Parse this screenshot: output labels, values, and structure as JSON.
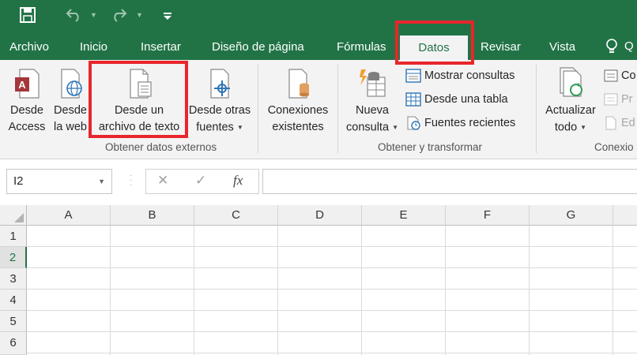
{
  "colors": {
    "accent": "#217346",
    "ribbon_bg": "#f3f3f3",
    "highlight": "#e8262b"
  },
  "qat": {
    "save_icon": "save-icon",
    "undo_icon": "undo-icon",
    "redo_icon": "redo-icon",
    "customize_icon": "customize-qat-icon"
  },
  "tabs": [
    {
      "label": "Archivo"
    },
    {
      "label": "Inicio"
    },
    {
      "label": "Insertar"
    },
    {
      "label": "Diseño de página"
    },
    {
      "label": "Fórmulas"
    },
    {
      "label": "Datos",
      "active": true
    },
    {
      "label": "Revisar"
    },
    {
      "label": "Vista"
    }
  ],
  "tell_me": {
    "icon": "lightbulb-icon",
    "label": "Q"
  },
  "ribbon": {
    "external": {
      "label": "Obtener datos externos",
      "access": {
        "line1": "Desde",
        "line2": "Access"
      },
      "web": {
        "line1": "Desde",
        "line2": "la web"
      },
      "text": {
        "line1": "Desde un",
        "line2": "archivo de texto"
      },
      "other": {
        "line1": "Desde otras",
        "line2": "fuentes"
      },
      "existing": {
        "line1": "Conexiones",
        "line2": "existentes"
      }
    },
    "transform": {
      "label": "Obtener y transformar",
      "new_query": {
        "line1": "Nueva",
        "line2": "consulta"
      },
      "show_queries": "Mostrar consultas",
      "from_table": "Desde una tabla",
      "recent": "Fuentes recientes"
    },
    "connections": {
      "label": "Conexio",
      "refresh": {
        "line1": "Actualizar",
        "line2": "todo"
      },
      "conn": "Co",
      "props": "Pr",
      "edit": "Ed"
    }
  },
  "formula_bar": {
    "name_box": "I2",
    "cancel": "✕",
    "enter": "✓",
    "fx": "fx",
    "value": ""
  },
  "grid": {
    "columns": [
      "A",
      "B",
      "C",
      "D",
      "E",
      "F",
      "G"
    ],
    "rows": [
      "1",
      "2",
      "3",
      "4",
      "5",
      "6"
    ],
    "selected_row": "2"
  }
}
